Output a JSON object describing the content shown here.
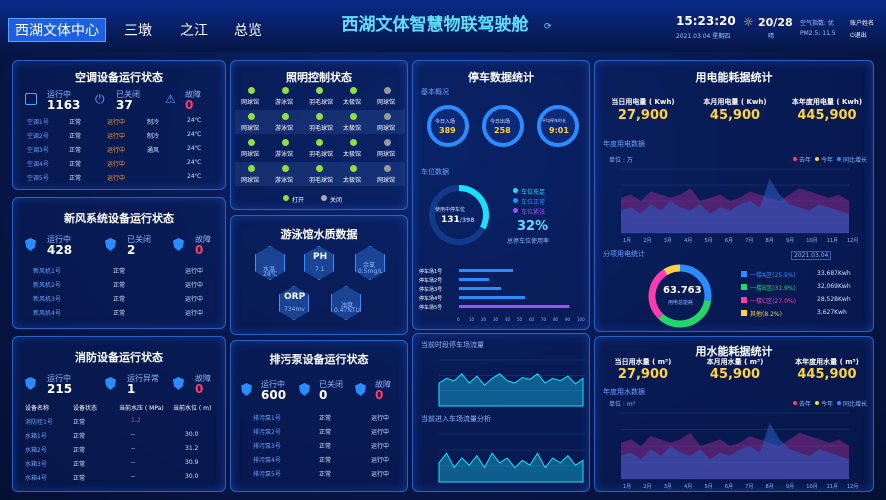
{
  "header": {
    "title": "西湖文体智慧物联驾驶舱",
    "nav": [
      "西湖文体中心",
      "三墩",
      "之江",
      "总览"
    ],
    "time": "15:23:20",
    "date": "2021.03.04 星期四",
    "weather_temp": "20/28",
    "weather_desc": "晴",
    "air_quality": "空气指数: 优",
    "pm25": "PM2.5: 11.5",
    "user_label": "账户姓名",
    "logout": "退出"
  },
  "ac": {
    "title": "空调设备运行状态",
    "running_label": "运行中",
    "running": "1163",
    "closed_label": "已关闭",
    "closed": "37",
    "fault_label": "故障",
    "fault": "0",
    "rows": [
      [
        "空调1号",
        "正常",
        "运行中",
        "制冷",
        "24℃"
      ],
      [
        "空调2号",
        "正常",
        "运行中",
        "制冷",
        "24℃"
      ],
      [
        "空调3号",
        "正常",
        "运行中",
        "通风",
        "24℃"
      ],
      [
        "空调4号",
        "正常",
        "运行中",
        "",
        "24℃"
      ],
      [
        "空调5号",
        "正常",
        "运行中",
        "",
        "24℃"
      ]
    ]
  },
  "fresh": {
    "title": "新风系统设备运行状态",
    "running_label": "运行中",
    "running": "428",
    "closed_label": "已关闭",
    "closed": "2",
    "fault_label": "故障",
    "fault": "0",
    "rows": [
      [
        "新风机1号",
        "正常",
        "运行中"
      ],
      [
        "新风机2号",
        "正常",
        "运行中"
      ],
      [
        "新风机3号",
        "正常",
        "运行中"
      ],
      [
        "新风机4号",
        "正常",
        "运行中"
      ]
    ]
  },
  "fire": {
    "title": "消防设备运行状态",
    "running_label": "运行中",
    "running": "215",
    "abn_label": "运行异常",
    "abn": "1",
    "fault_label": "故障",
    "fault": "0",
    "headers": [
      "设备名称",
      "设备状态",
      "当前水压 ( MPa)",
      "当前水位 ( m)"
    ],
    "rows": [
      [
        "消防栓1号",
        "正常",
        "1.2",
        ""
      ],
      [
        "水箱1号",
        "正常",
        "--",
        "30.0"
      ],
      [
        "水箱2号",
        "正常",
        "--",
        "31.2"
      ],
      [
        "水箱3号",
        "正常",
        "--",
        "30.9"
      ],
      [
        "水箱4号",
        "正常",
        "--",
        "30.0"
      ]
    ]
  },
  "light": {
    "title": "照明控制状态",
    "rows": [
      [
        "网球馆",
        "游泳馆",
        "羽毛球馆",
        "太极馆",
        "网球馆"
      ],
      [
        "网球馆",
        "游泳馆",
        "羽毛球馆",
        "太极馆",
        "网球馆"
      ],
      [
        "网球馆",
        "游泳馆",
        "羽毛球馆",
        "太极馆",
        "网球馆"
      ],
      [
        "网球馆",
        "游泳馆",
        "羽毛球馆",
        "太极馆",
        "网球馆"
      ]
    ],
    "on": "打开",
    "off": "关闭"
  },
  "water": {
    "title": "游泳馆水质数据",
    "temp_label": "水温",
    "temp": "28℃",
    "ph_label": "PH",
    "ph": "7.1",
    "cl_label": "余氯",
    "cl": "0.5mg/L",
    "orp_label": "ORP",
    "orp": "734mv",
    "turb_label": "浊度",
    "turb": "0.47NTU"
  },
  "sewage": {
    "title": "排污泵设备运行状态",
    "running_label": "运行中",
    "running": "600",
    "closed_label": "已关闭",
    "closed": "0",
    "fault_label": "故障",
    "fault": "0",
    "rows": [
      [
        "排污泵1号",
        "正常",
        "运行中"
      ],
      [
        "排污泵2号",
        "正常",
        "运行中"
      ],
      [
        "排污泵3号",
        "正常",
        "运行中"
      ],
      [
        "排污泵4号",
        "正常",
        "运行中"
      ],
      [
        "排污泵5号",
        "正常",
        "运行中"
      ]
    ]
  },
  "parking": {
    "title": "停车数据统计",
    "basic": "基本概况",
    "enter_label": "今日入场",
    "enter": "389",
    "exit_label": "今日出场",
    "exit": "258",
    "avg_label": "平均停车时长",
    "avg": "9:01",
    "space": "车位数据",
    "usage_label": "使用中停车位",
    "usage_num": "131",
    "usage_total": "398",
    "usage_pct": "32%",
    "usage_rate": "总停车位使用率",
    "legend": [
      "车位充足",
      "车位正常",
      "车位紧张"
    ],
    "bars": [
      "停车场1号",
      "停车场2号",
      "停车场3号",
      "停车场4号",
      "停车场5号"
    ],
    "ticks": [
      "0",
      "10",
      "20",
      "30",
      "40",
      "50",
      "60",
      "70",
      "80",
      "90",
      "100"
    ],
    "flow_title": "当前时段停车场流量",
    "flow2_title": "当前进入车场流量分析"
  },
  "elec": {
    "title": "用电能耗据统计",
    "day_label": "当日用电量 ( Kwh)",
    "day": "27,900",
    "month_label": "本月用电量 ( Kwh)",
    "month": "45,900",
    "year_label": "本年度用电量 ( Kwh)",
    "year": "445,900",
    "sub": "年度用电数据",
    "unit": "单位 : 万",
    "legend": [
      "去年",
      "今年",
      "同比增长"
    ],
    "months": [
      "1月",
      "2月",
      "3月",
      "4月",
      "5月",
      "6月",
      "7月",
      "8月",
      "9月",
      "10月",
      "11月",
      "12月"
    ],
    "pie_title": "分项用电统计",
    "pie_date": "2021.03.04",
    "pie_val": "63.763",
    "pie_sub": "用电总能耗",
    "pie_items": [
      [
        "一楼A区(25.5%)",
        "33,687Kwh"
      ],
      [
        "一楼B区(31.9%)",
        "32,069Kwh"
      ],
      [
        "一楼C区(27.0%)",
        "28,528Kwh"
      ],
      [
        "其他(8.2%)",
        "3,627Kwh"
      ]
    ],
    "colors": [
      "#2b8cff",
      "#22d66a",
      "#ff3bb0",
      "#ffd23f"
    ]
  },
  "waterEnergy": {
    "title": "用水能耗据统计",
    "day_label": "当日用水量 ( m³)",
    "day": "27,900",
    "month_label": "本月用水量 ( m³)",
    "month": "45,900",
    "year_label": "本年度用水量 ( m³)",
    "year": "445,900",
    "sub": "年度用水数据",
    "unit": "单位 : m³",
    "legend": [
      "去年",
      "今年",
      "同比增长"
    ]
  }
}
